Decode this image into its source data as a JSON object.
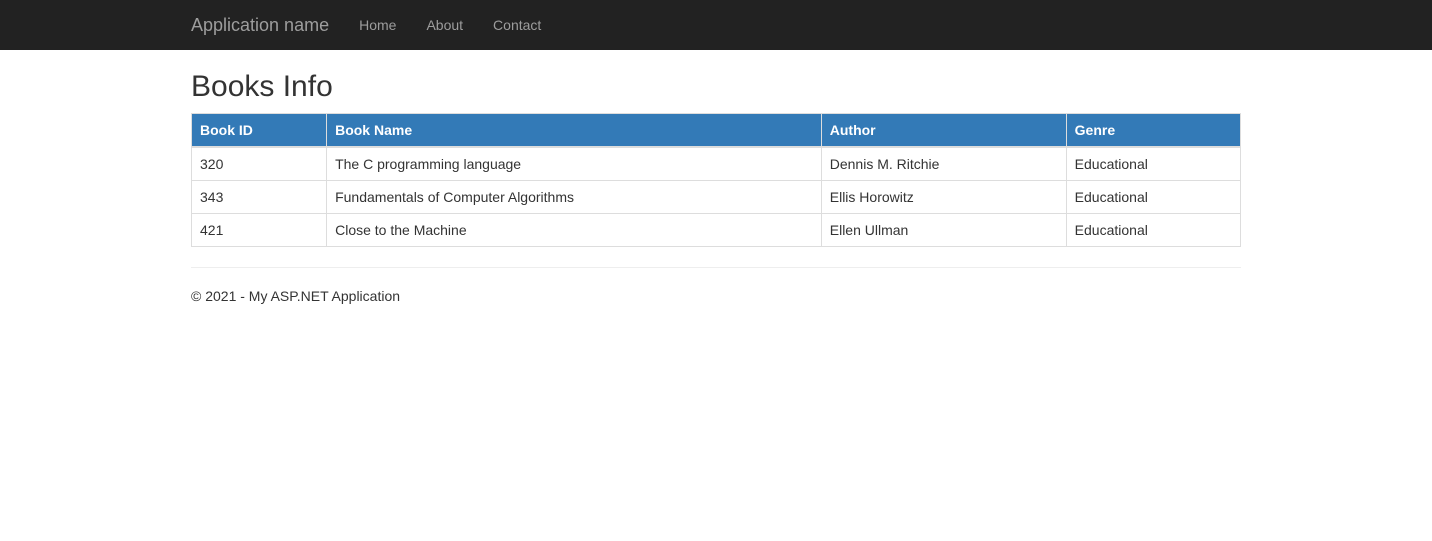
{
  "navbar": {
    "brand": "Application name",
    "links": [
      {
        "label": "Home"
      },
      {
        "label": "About"
      },
      {
        "label": "Contact"
      }
    ]
  },
  "page": {
    "title": "Books Info"
  },
  "table": {
    "headers": {
      "book_id": "Book ID",
      "book_name": "Book Name",
      "author": "Author",
      "genre": "Genre"
    },
    "rows": [
      {
        "book_id": "320",
        "book_name": "The C programming language",
        "author": "Dennis M. Ritchie",
        "genre": "Educational"
      },
      {
        "book_id": "343",
        "book_name": "Fundamentals of Computer Algorithms",
        "author": "Ellis Horowitz",
        "genre": "Educational"
      },
      {
        "book_id": "421",
        "book_name": "Close to the Machine",
        "author": "Ellen Ullman",
        "genre": "Educational"
      }
    ]
  },
  "footer": {
    "text": "© 2021 - My ASP.NET Application"
  }
}
